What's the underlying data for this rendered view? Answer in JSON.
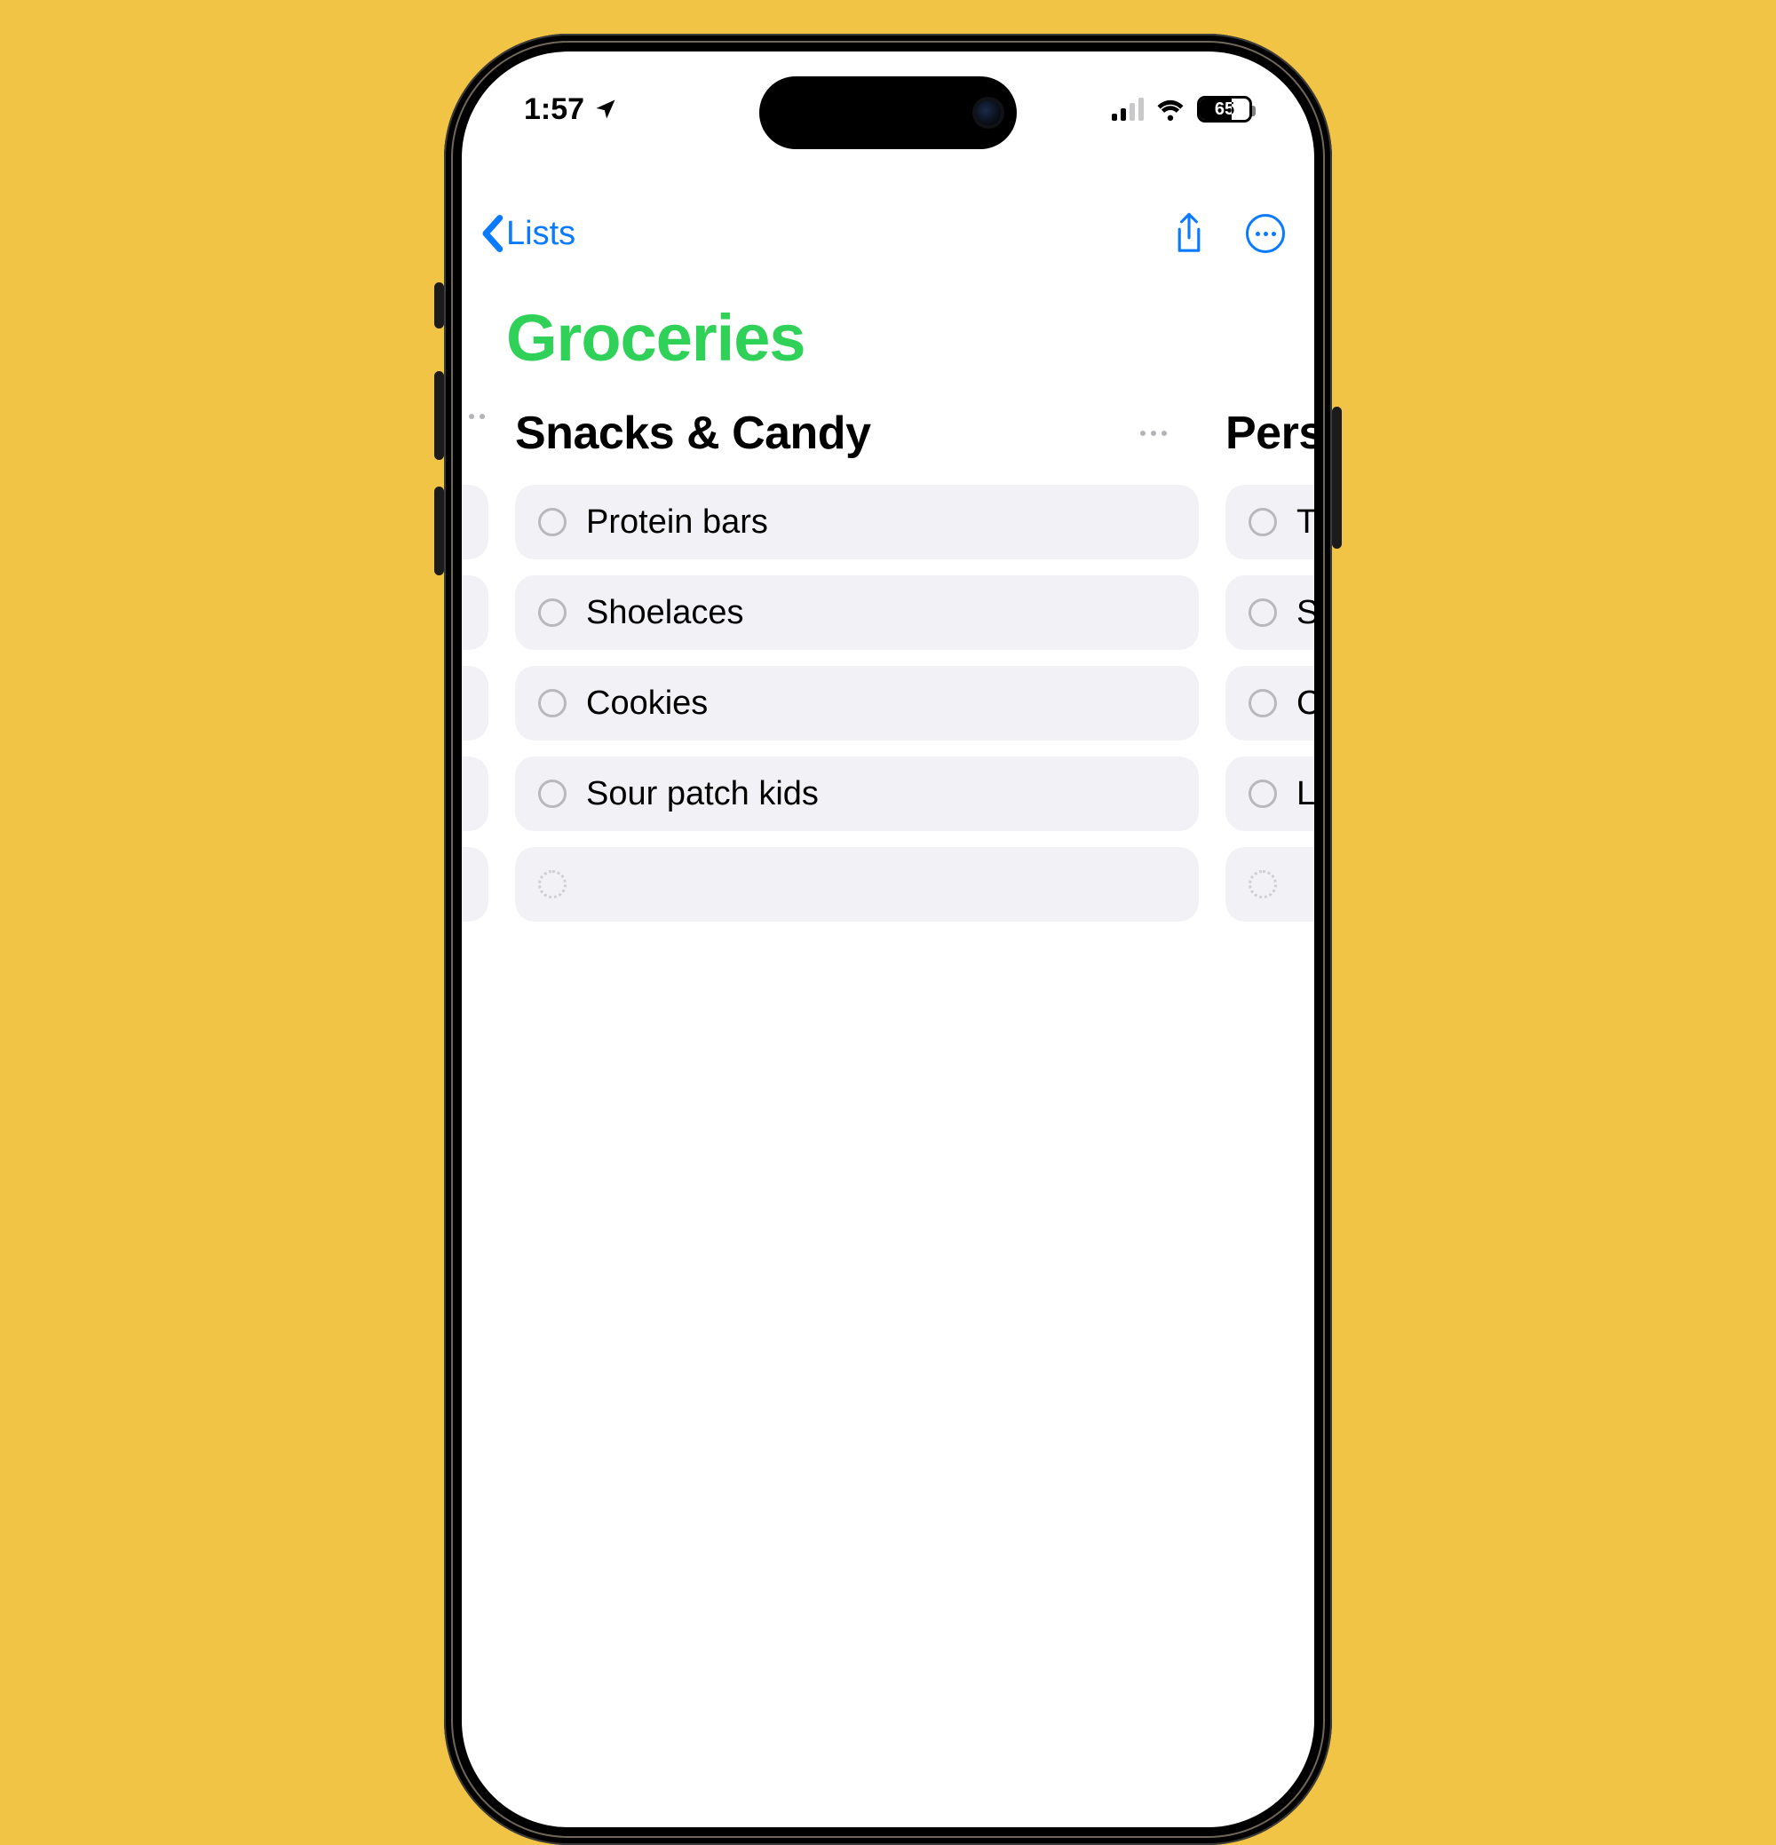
{
  "status": {
    "time": "1:57",
    "battery": "65"
  },
  "nav": {
    "back_label": "Lists"
  },
  "list": {
    "title": "Groceries"
  },
  "columns": [
    {
      "title": "Snacks & Candy",
      "items": [
        "Protein bars",
        "Shoelaces",
        "Cookies",
        "Sour patch kids"
      ]
    },
    {
      "title": "Pers",
      "items": [
        "To",
        "Sh",
        "Co",
        "Li"
      ]
    }
  ]
}
